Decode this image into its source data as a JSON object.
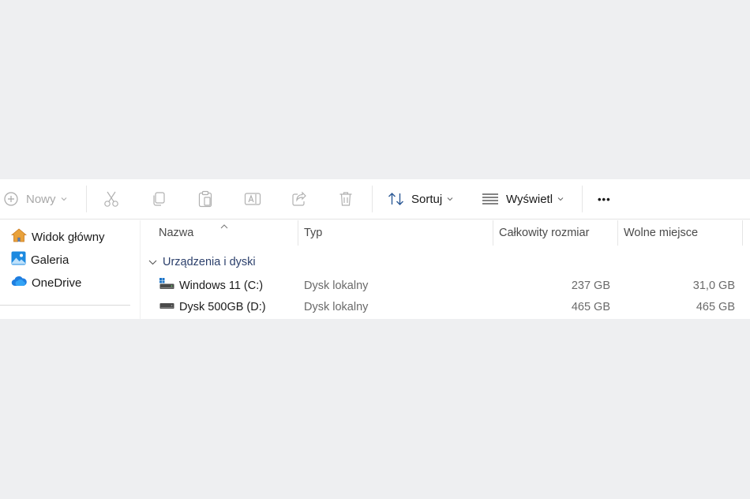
{
  "toolbar": {
    "new_label": "Nowy",
    "sort_label": "Sortuj",
    "view_label": "Wyświetl",
    "more_label": "•••"
  },
  "sidebar": {
    "items": [
      {
        "label": "Widok główny",
        "icon": "home-icon"
      },
      {
        "label": "Galeria",
        "icon": "gallery-icon"
      },
      {
        "label": "OneDrive",
        "icon": "onedrive-icon"
      }
    ]
  },
  "columns": {
    "name": "Nazwa",
    "type": "Typ",
    "total": "Całkowity rozmiar",
    "free": "Wolne miejsce"
  },
  "group": {
    "label": "Urządzenia i dyski"
  },
  "drives": [
    {
      "name": "Windows 11 (C:)",
      "type": "Dysk lokalny",
      "total": "237 GB",
      "free": "31,0 GB",
      "icon": "system-drive-icon"
    },
    {
      "name": "Dysk 500GB (D:)",
      "type": "Dysk lokalny",
      "total": "465 GB",
      "free": "465 GB",
      "icon": "drive-icon"
    }
  ],
  "colors": {
    "accent": "#2b3f6b",
    "folder_blue": "#1d8ae0",
    "home_orange": "#e9a23b"
  }
}
